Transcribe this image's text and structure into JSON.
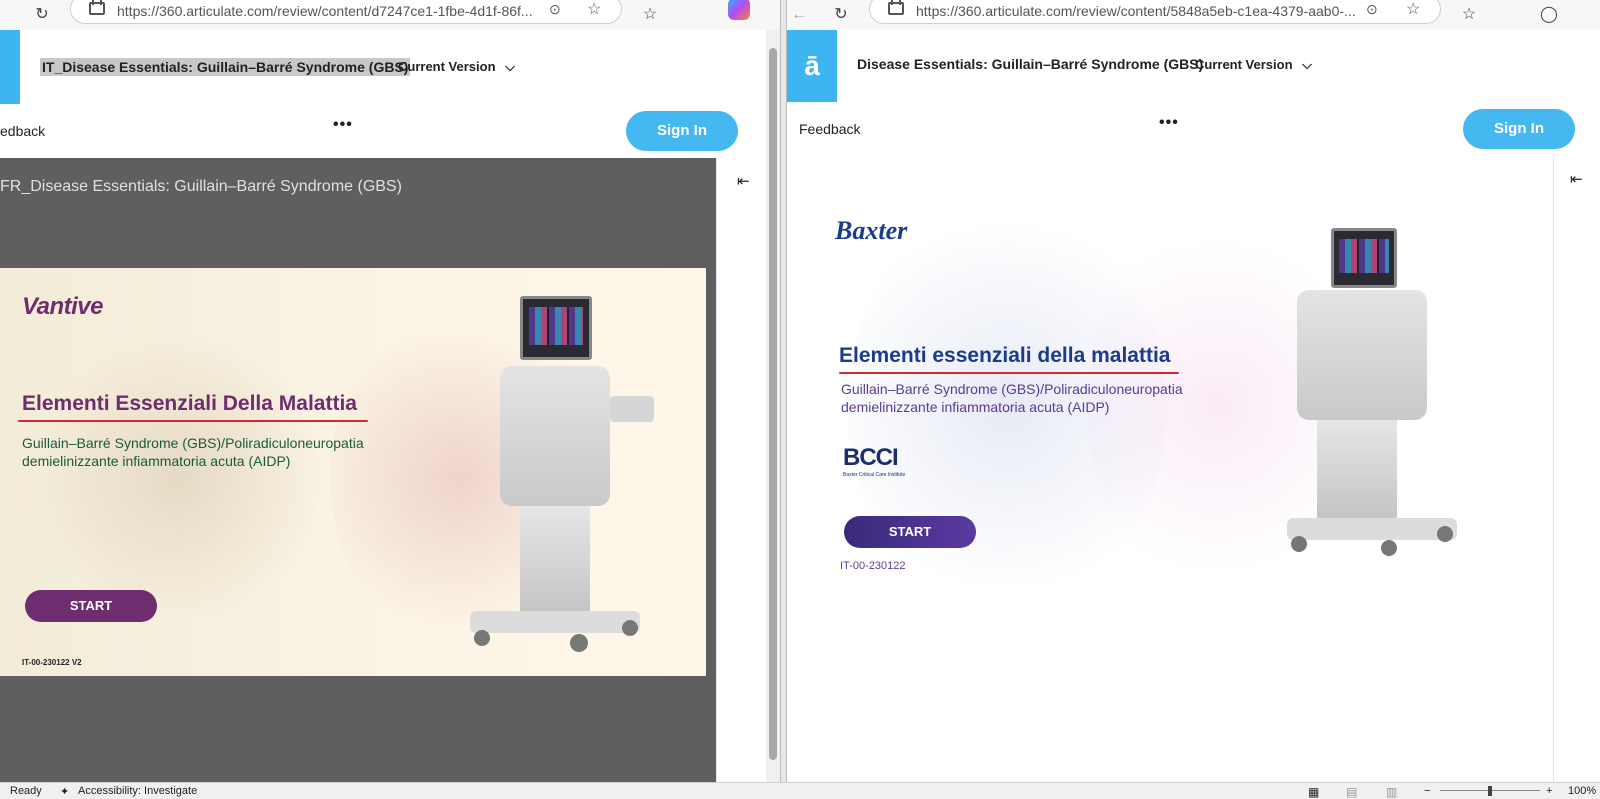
{
  "left": {
    "url": "https://360.articulate.com/review/content/d7247ce1-1fbe-4d1f-86f...",
    "doc_title": "IT_Disease Essentials: Guillain–Barré Syndrome (GBS)",
    "version": "Current Version",
    "feedback": "edback",
    "more": "•••",
    "sign_in": "Sign In",
    "slide_header": "FR_Disease Essentials: Guillain–Barré Syndrome (GBS)",
    "brand": "Vantive",
    "title": "Elementi Essenziali Della Malattia",
    "subtitle_1": "Guillain–Barré Syndrome (GBS)/Poliradiculoneuropatia",
    "subtitle_2": "demielinizzante infiammatoria acuta (AIDP)",
    "start": "START",
    "code": "IT-00-230122 V2"
  },
  "right": {
    "url": "https://360.articulate.com/review/content/5848a5eb-c1ea-4379-aab0-...",
    "doc_title": "Disease Essentials: Guillain–Barré Syndrome (GBS)",
    "version": "Current Version",
    "feedback": "Feedback",
    "more": "•••",
    "sign_in": "Sign In",
    "brand": "Baxter",
    "title": "Elementi essenziali della malattia",
    "subtitle_1": "Guillain–Barré Syndrome (GBS)/Poliradiculoneuropatia",
    "subtitle_2": "demielinizzante infiammatoria acuta (AIDP)",
    "bcci": "BCCI",
    "bcci_sub": "Baxter Critical Care Institute",
    "start": "START",
    "code": "IT-00-230122"
  },
  "status": {
    "ready": "Ready",
    "accessibility": "Accessibility: Investigate",
    "zoom": "100%"
  },
  "colors": {
    "accent_blue": "#45b8f2",
    "vantive_purple": "#6e2d6e",
    "baxter_blue": "#1b3b8f",
    "baxter_purple": "#4a2a88"
  }
}
